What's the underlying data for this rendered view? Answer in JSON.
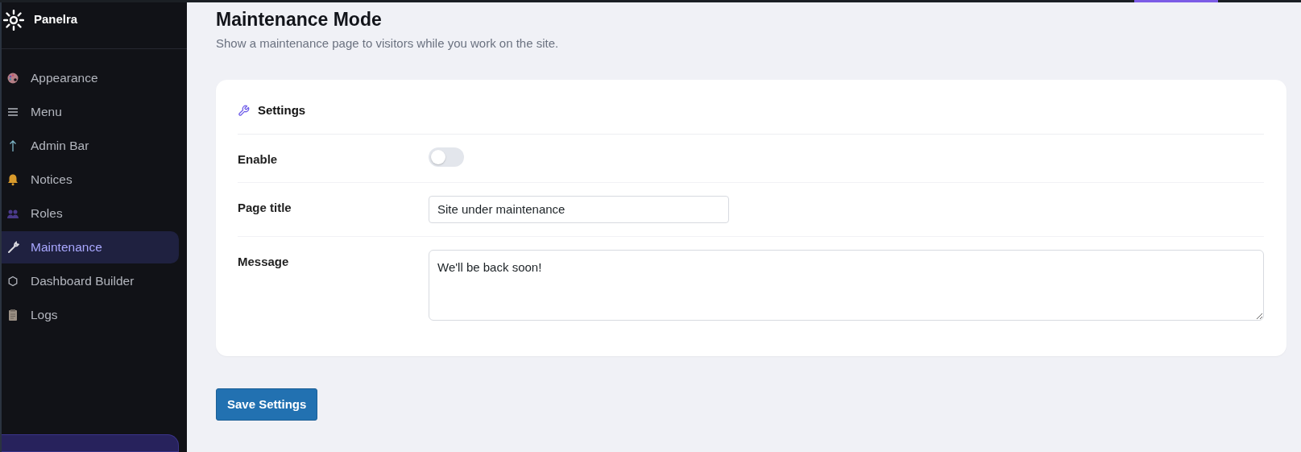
{
  "brand": {
    "name": "Panelra"
  },
  "sidebar": {
    "items": [
      {
        "label": "Appearance",
        "selected": false
      },
      {
        "label": "Menu",
        "selected": false
      },
      {
        "label": "Admin Bar",
        "selected": false
      },
      {
        "label": "Notices",
        "selected": false
      },
      {
        "label": "Roles",
        "selected": false
      },
      {
        "label": "Maintenance",
        "selected": true
      },
      {
        "label": "Dashboard Builder",
        "selected": false
      },
      {
        "label": "Logs",
        "selected": false
      }
    ]
  },
  "page": {
    "title": "Maintenance Mode",
    "subtitle": "Show a maintenance page to visitors while you work on the site."
  },
  "card": {
    "title": "Settings",
    "fields": [
      {
        "kind": "toggle",
        "label": "Enable",
        "on": false
      },
      {
        "kind": "text",
        "label": "Page title",
        "value": "Site under maintenance"
      },
      {
        "kind": "textarea",
        "label": "Message",
        "value": "We'll be back soon!"
      }
    ]
  },
  "save_button": "Save Settings"
}
